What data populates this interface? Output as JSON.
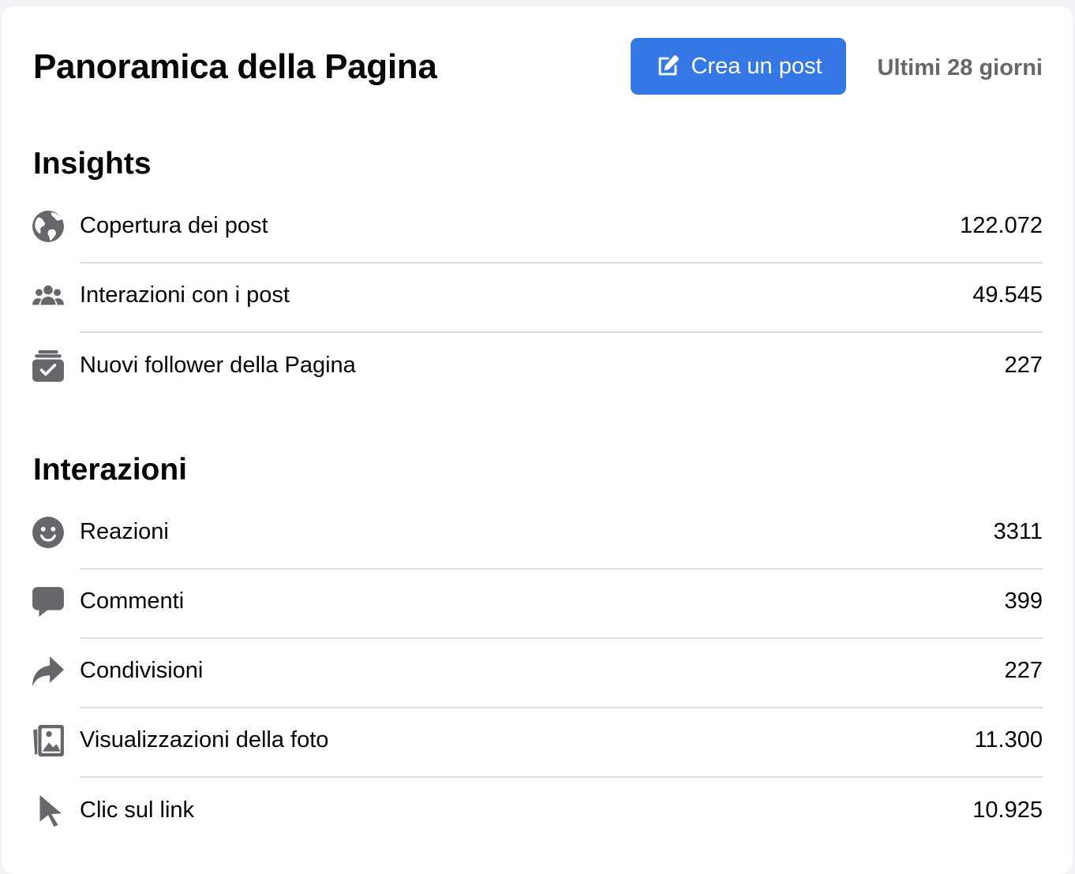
{
  "header": {
    "title": "Panoramica della Pagina",
    "create_post_label": "Crea un post",
    "range_label": "Ultimi 28 giorni"
  },
  "insights": {
    "title": "Insights",
    "rows": [
      {
        "label": "Copertura dei post",
        "value": "122.072",
        "icon": "globe-icon"
      },
      {
        "label": "Interazioni con i post",
        "value": "49.545",
        "icon": "people-icon"
      },
      {
        "label": "Nuovi follower della Pagina",
        "value": "227",
        "icon": "follower-check-icon"
      }
    ]
  },
  "interactions": {
    "title": "Interazioni",
    "rows": [
      {
        "label": "Reazioni",
        "value": "3311",
        "icon": "smiley-icon"
      },
      {
        "label": "Commenti",
        "value": "399",
        "icon": "comment-bubble-icon"
      },
      {
        "label": "Condivisioni",
        "value": "227",
        "icon": "share-arrow-icon"
      },
      {
        "label": "Visualizzazioni della foto",
        "value": "11.300",
        "icon": "photo-icon"
      },
      {
        "label": "Clic sul link",
        "value": "10.925",
        "icon": "cursor-icon"
      }
    ]
  },
  "colors": {
    "accent": "#3578e5",
    "icon": "#65676b",
    "secondary_text": "#65676b",
    "divider": "#dcdfe3"
  }
}
